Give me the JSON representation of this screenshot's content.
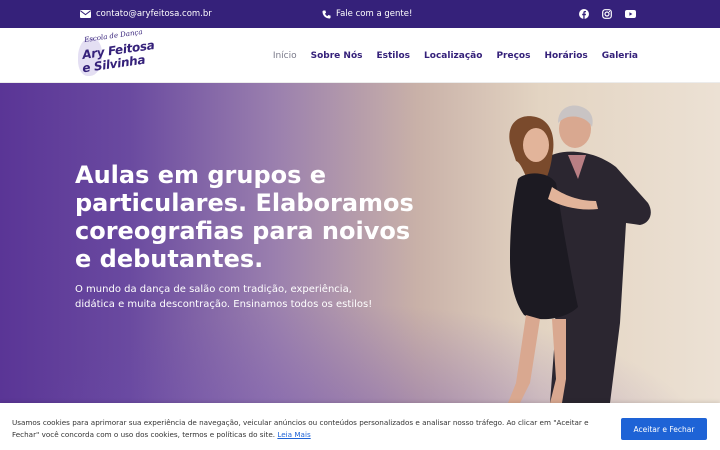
{
  "topbar": {
    "email": "contato@aryfeitosa.com.br",
    "phone": "Fale com a gente!",
    "social_icons": [
      "facebook-icon",
      "instagram-icon",
      "youtube-icon"
    ]
  },
  "logo": {
    "script": "Escola de Dança",
    "line1": "Ary Feitosa",
    "line2": "e Silvinha"
  },
  "nav": {
    "items": [
      "Início",
      "Sobre Nós",
      "Estilos",
      "Localização",
      "Preços",
      "Horários",
      "Galeria"
    ],
    "active": "Início"
  },
  "hero": {
    "title": "Aulas em grupos e particulares. Elaboramos coreografias para noivos e debutantes.",
    "subtitle": "O mundo da dança de salão com tradição, experiência, didática e muita descontração. Ensinamos todos os estilos!"
  },
  "cookie": {
    "text": "Usamos cookies para aprimorar sua experiência de navegação, veicular anúncios ou conteúdos personalizados e analisar nosso tráfego. Ao clicar em \"Aceitar e Fechar\" você concorda com o uso dos cookies, termos e políticas do site.",
    "link": "Leia Mais",
    "button": "Aceitar e Fechar"
  },
  "colors": {
    "brand": "#35217a",
    "link": "#1e63d6"
  }
}
